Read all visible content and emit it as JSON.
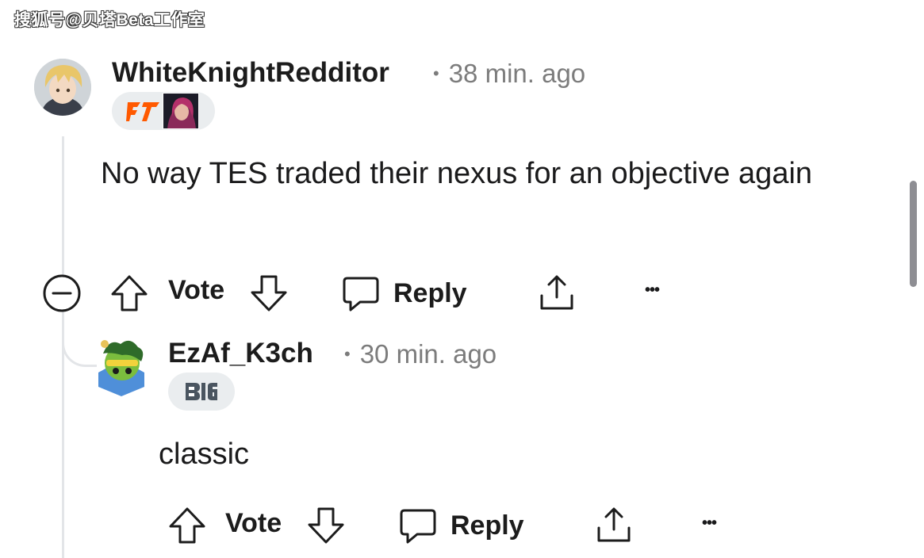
{
  "watermark": "搜狐号@贝塔Beta工作室",
  "comments": [
    {
      "username": "WhiteKnightRedditor",
      "time": "38 min. ago",
      "text": "No way TES traded their nexus for an objective again",
      "flair_icons": [
        "fnatic-logo-icon",
        "champion-portrait-icon"
      ],
      "actions": {
        "vote": "Vote",
        "reply": "Reply",
        "more": "•••"
      }
    },
    {
      "username": "EzAf_K3ch",
      "time": "30 min. ago",
      "text": "classic",
      "flair_icons": [
        "blg-logo-icon"
      ],
      "actions": {
        "vote": "Vote",
        "reply": "Reply",
        "more": "•••"
      }
    }
  ],
  "colors": {
    "background": "#ffffff",
    "meta_text": "#7c7c7c",
    "flair_bg": "#eaedef",
    "fnatic_orange": "#ff5900",
    "thread_line": "#e3e5e8"
  }
}
